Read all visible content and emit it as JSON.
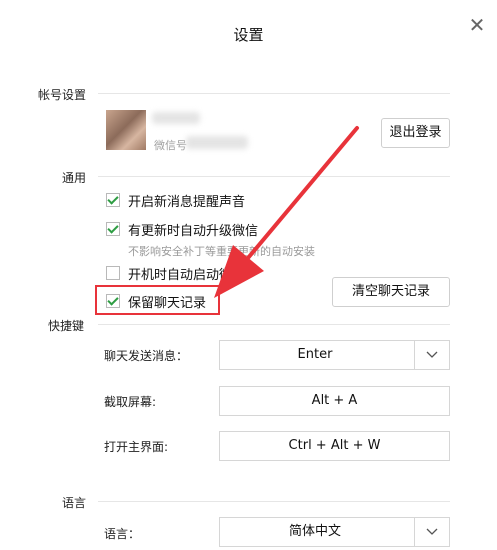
{
  "window": {
    "title": "设置",
    "close_symbol": "✕"
  },
  "account": {
    "section_label": "帐号设置",
    "wechat_id_prefix": "微信号",
    "logout_label": "退出登录"
  },
  "general": {
    "section_label": "通用",
    "options": [
      {
        "label": "开启新消息提醒声音",
        "checked": true
      },
      {
        "label": "有更新时自动升级微信",
        "checked": true
      },
      {
        "label": "开机时自动启动微信",
        "checked": false
      },
      {
        "label": "保留聊天记录",
        "checked": true
      }
    ],
    "update_note": "不影响安全补丁等重要更新的自动安装",
    "clear_history_label": "清空聊天记录"
  },
  "shortcuts": {
    "section_label": "快捷键",
    "items": [
      {
        "label": "聊天发送消息：",
        "value": "Enter"
      },
      {
        "label": "截取屏幕:",
        "value": "Alt + A"
      },
      {
        "label": "打开主界面:",
        "value": "Ctrl + Alt + W"
      }
    ]
  },
  "language": {
    "section_label": "语言",
    "label": "语言：",
    "value": "简体中文"
  },
  "colors": {
    "highlight": "#e8333a",
    "check": "#2e9d43"
  }
}
